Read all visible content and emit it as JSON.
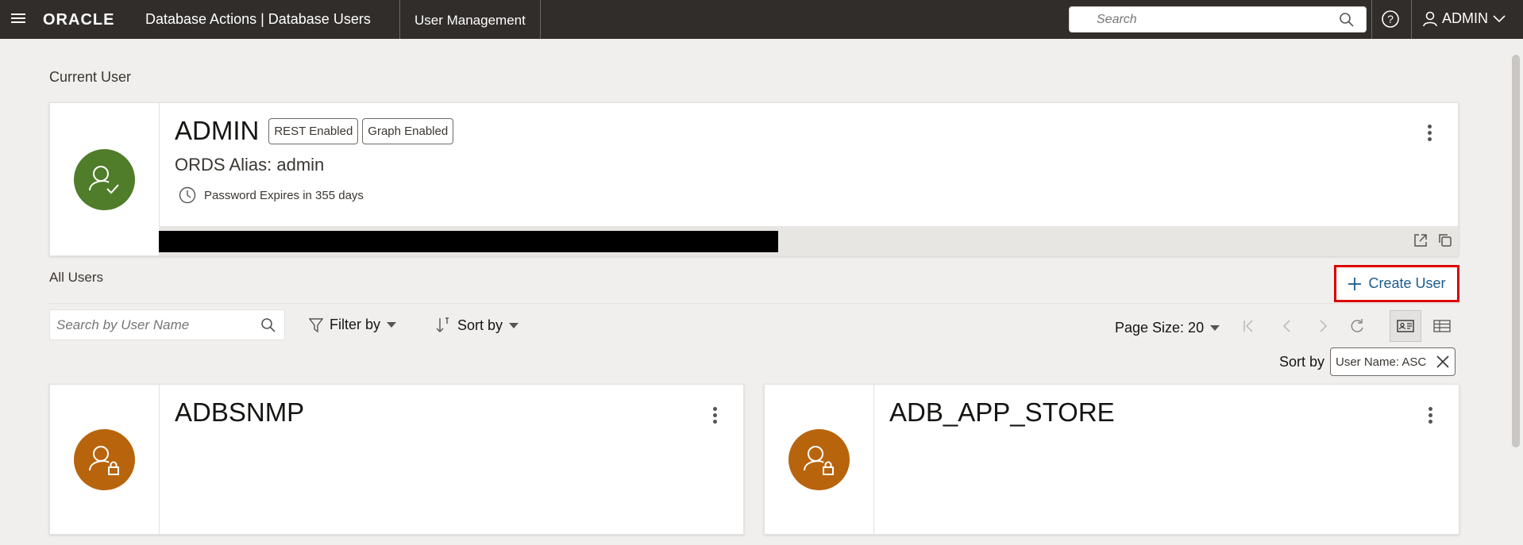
{
  "topbar": {
    "brand": "ORACLE",
    "app_title": "Database Actions |  Database Users",
    "section": "User Management",
    "search_placeholder": "Search",
    "user": "ADMIN"
  },
  "current_user": {
    "heading": "Current User",
    "name": "ADMIN",
    "badges": [
      "REST Enabled",
      "Graph Enabled"
    ],
    "alias": "ORDS Alias: admin",
    "password_expiry": "Password Expires in 355 days",
    "avatar_color": "#4f7d2a"
  },
  "all_users": {
    "heading": "All Users",
    "create_button": "Create User",
    "search_placeholder": "Search by User Name",
    "filter_label": "Filter by",
    "sort_label": "Sort by",
    "page_size": "Page Size: 20",
    "sort_by_label": "Sort by",
    "sort_chip": "User Name: ASC",
    "users": [
      {
        "name": "ADBSNMP",
        "avatar_color": "#b8640d"
      },
      {
        "name": "ADB_APP_STORE",
        "avatar_color": "#b8640d"
      }
    ]
  },
  "icons": {
    "menu": "hamburger-icon",
    "search": "search-icon",
    "help": "help-icon",
    "user": "user-icon",
    "chevron": "chevron-down-icon",
    "clock": "clock-icon",
    "external": "external-link-icon",
    "copy": "copy-icon",
    "plus": "plus-icon",
    "filter": "filter-icon",
    "sort": "sort-icon",
    "first": "first-page-icon",
    "prev": "previous-page-icon",
    "next": "next-page-icon",
    "refresh": "refresh-icon",
    "card_view": "card-view-icon",
    "grid_view": "grid-view-icon",
    "close": "close-icon",
    "kebab": "kebab-menu-icon",
    "user_check": "user-check-icon",
    "user_lock": "user-lock-icon"
  }
}
